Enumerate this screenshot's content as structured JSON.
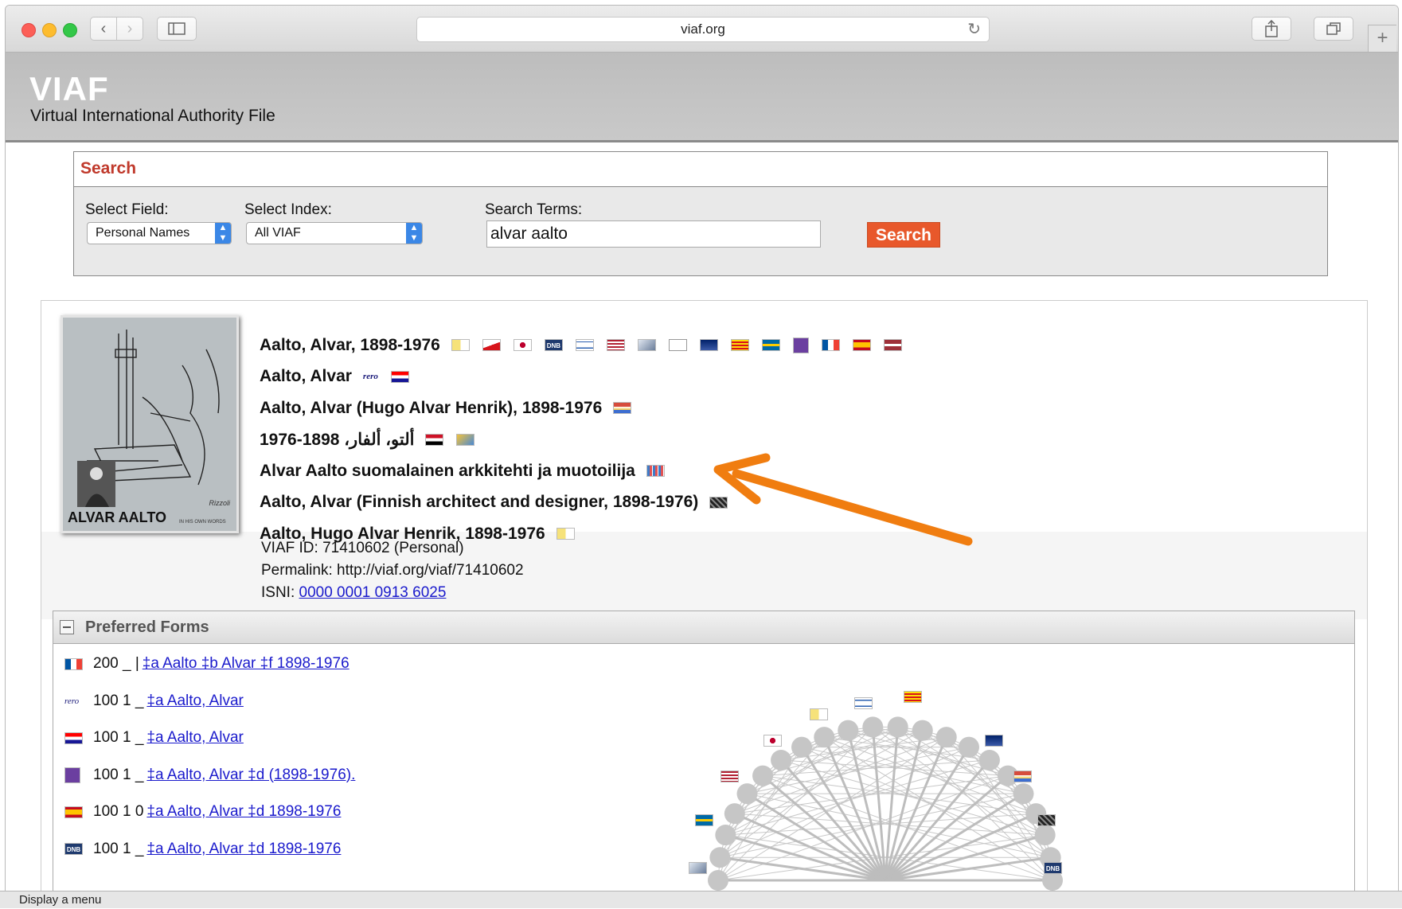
{
  "browser": {
    "url": "viaf.org",
    "status_text": "Display a menu"
  },
  "site": {
    "logo": "VIAF",
    "subtitle": "Virtual International Authority File"
  },
  "search": {
    "title": "Search",
    "field_label": "Select Field:",
    "field_value": "Personal Names",
    "index_label": "Select Index:",
    "index_value": "All VIAF",
    "terms_label": "Search Terms:",
    "terms_value": "alvar aalto",
    "button_label": "Search"
  },
  "result": {
    "cover_title": "ALVAR AALTO",
    "cover_subtitle": "IN HIS OWN WORDS",
    "cover_publisher": "Rizzoli",
    "headings": [
      {
        "text": "Aalto, Alvar, 1898-1976",
        "flags": [
          "vatican",
          "czech",
          "japan",
          "dnb",
          "israel",
          "usa",
          "cube",
          "blank",
          "australia",
          "catalonia",
          "sweden",
          "nukat",
          "france",
          "spain",
          "latvia"
        ]
      },
      {
        "text": "Aalto, Alvar",
        "flags": [
          "rero",
          "croatia"
        ]
      },
      {
        "text": "Aalto, Alvar (Hugo Alvar Henrik), 1898-1976",
        "flags": [
          "portugal"
        ]
      },
      {
        "text": "ألتو، ألفار، 1898-1976",
        "flags": [
          "egypt",
          "wiki"
        ]
      },
      {
        "text": "Alvar Aalto suomalainen arkkitehti ja muotoilija",
        "flags": [
          "bars"
        ]
      },
      {
        "text": "Aalto, Alvar (Finnish architect and designer, 1898-1976)",
        "flags": [
          "puzzle"
        ]
      },
      {
        "text": "Aalto, Hugo Alvar Henrik, 1898-1976",
        "flags": [
          "vatican"
        ]
      }
    ],
    "viaf_id_line": "VIAF ID: 71410602 (Personal)",
    "permalink_line": "Permalink: http://viaf.org/viaf/71410602",
    "isni_label": "ISNI:",
    "isni_value": "0000 0001 0913 6025"
  },
  "preferred_forms": {
    "title": "Preferred Forms",
    "rows": [
      {
        "icon": "france",
        "prefix": "200 _ |",
        "link": "‡a  Aalto ‡b  Alvar ‡f  1898-1976"
      },
      {
        "icon": "rero",
        "prefix": "100 1 _",
        "link": "‡a  Aalto, Alvar"
      },
      {
        "icon": "croatia",
        "prefix": "100 1 _",
        "link": "‡a  Aalto, Alvar"
      },
      {
        "icon": "nukat",
        "prefix": "100 1 _",
        "link": "‡a  Aalto, Alvar ‡d  (1898-1976)."
      },
      {
        "icon": "spain",
        "prefix": "100 1 0",
        "link": "‡a  Aalto, Alvar ‡d  1898-1976"
      },
      {
        "icon": "dnb",
        "prefix": "100 1 _",
        "link": "‡a  Aalto, Alvar ‡d  1898-1976"
      }
    ],
    "rero_text": "rero",
    "dnb_text": "DNB"
  },
  "colors": {
    "accent": "#e8582b",
    "search_title": "#c0392b",
    "link": "#1a1acc",
    "arrow": "#f07d10"
  }
}
